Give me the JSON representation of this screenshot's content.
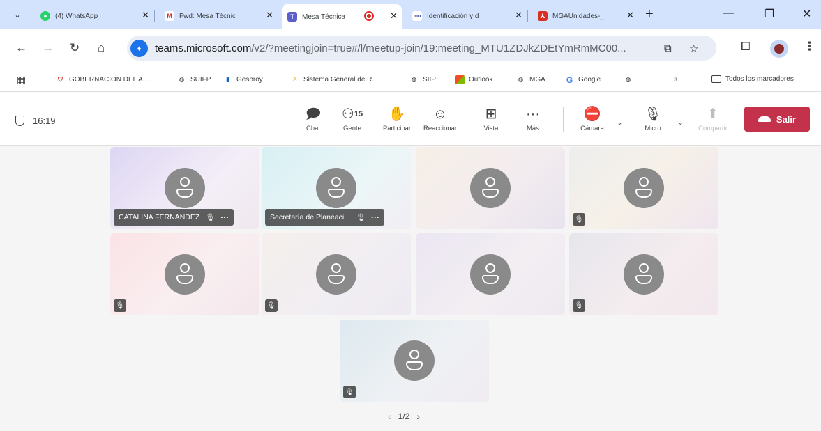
{
  "browser": {
    "tabs": [
      {
        "label": "(4) WhatsApp",
        "icon": "whatsapp-icon"
      },
      {
        "label": "Fwd: Mesa Técnic",
        "icon": "gmail-icon"
      },
      {
        "label": "Mesa Técnica",
        "icon": "teams-icon",
        "active": true
      },
      {
        "label": "Identificación y d",
        "icon": "mga-icon"
      },
      {
        "label": "MGAUnidades-_",
        "icon": "pdf-icon"
      }
    ],
    "url_host": "teams.microsoft.com",
    "url_path": "/v2/?meetingjoin=true#/l/meetup-join/19:meeting_MTU1ZDJkZDEtYmRmMC00...",
    "bookmarks": [
      {
        "label": "GOBERNACION DEL A...",
        "icon": "shield-icon"
      },
      {
        "label": "SUIFP",
        "icon": "globe-icon"
      },
      {
        "label": "Gesproy",
        "icon": "gesproy-icon"
      },
      {
        "label": "Sistema General de R...",
        "icon": "sgr-icon"
      },
      {
        "label": "SIIP",
        "icon": "globe-icon"
      },
      {
        "label": "Outlook",
        "icon": "outlook-icon"
      },
      {
        "label": "MGA",
        "icon": "globe-icon"
      },
      {
        "label": "Google",
        "icon": "google-icon"
      }
    ],
    "bookmarks_more": "»",
    "all_bookmarks": "Todos los marcadores"
  },
  "meeting": {
    "timer": "16:19",
    "controls": {
      "chat": "Chat",
      "people": "Gente",
      "people_count": "15",
      "raise": "Participar",
      "react": "Reaccionar",
      "view": "Vista",
      "more": "Más",
      "camera": "Cámara",
      "mic": "Micro",
      "share": "Compartir",
      "leave": "Salir"
    },
    "tiles": [
      {
        "name": "CATALINA FERNANDEZ",
        "muted": true
      },
      {
        "name": "Secretaría de Planeaci...",
        "muted": true
      },
      {
        "name": "",
        "muted": false
      },
      {
        "name": "",
        "muted": true
      },
      {
        "name": "",
        "muted": true
      },
      {
        "name": "",
        "muted": true
      },
      {
        "name": "",
        "muted": false
      },
      {
        "name": "",
        "muted": true
      },
      {
        "name": "",
        "muted": true
      }
    ],
    "page": "1/2"
  },
  "colors": {
    "tabstrip": "#d3e3fd",
    "leave": "#c4314b"
  }
}
